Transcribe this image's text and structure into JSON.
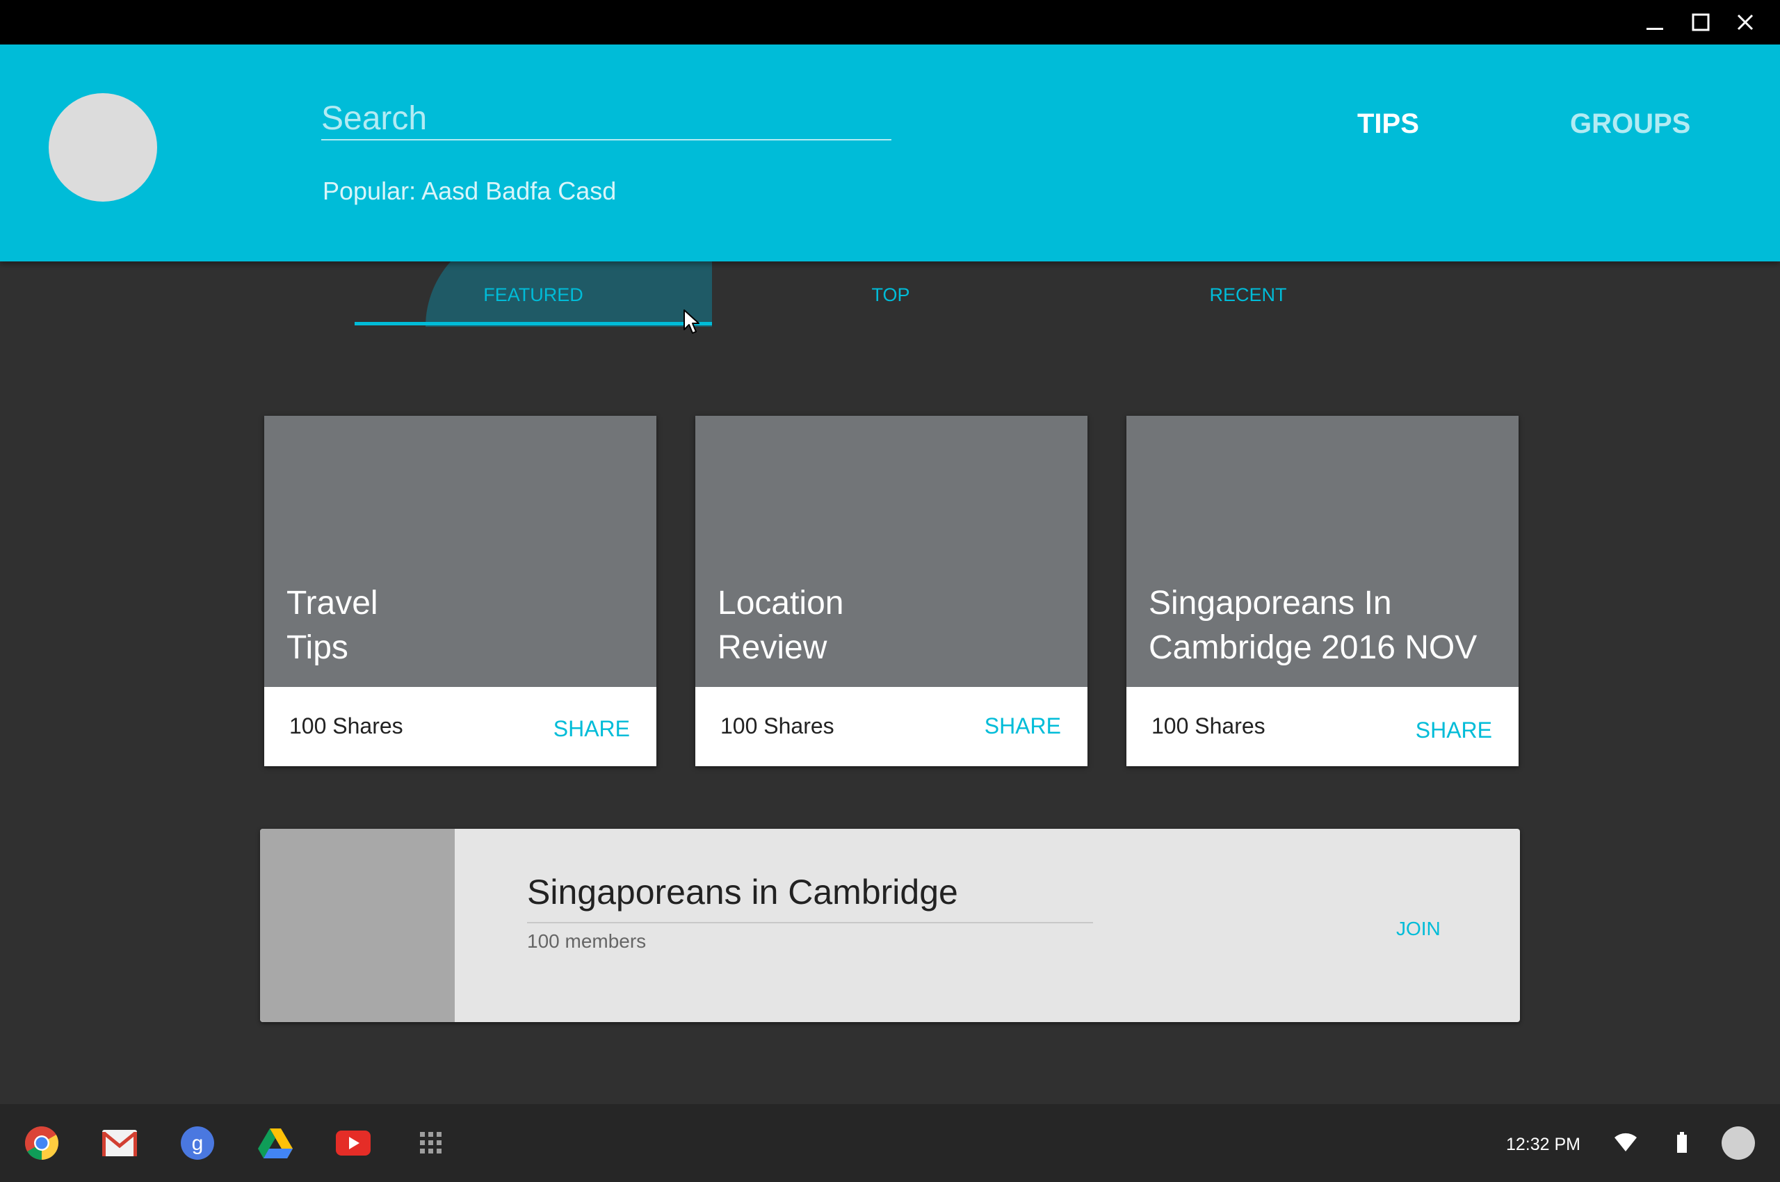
{
  "window": {
    "controls": {
      "minimize": "minimize-icon",
      "maximize": "maximize-icon",
      "close": "close-icon"
    }
  },
  "header": {
    "search": {
      "placeholder": "Search",
      "value": ""
    },
    "popular": "Popular: Aasd Badfa Casd",
    "nav": [
      {
        "label": "TIPS",
        "active": true
      },
      {
        "label": "GROUPS",
        "active": false
      }
    ]
  },
  "subtabs": [
    {
      "label": "FEATURED",
      "active": true
    },
    {
      "label": "TOP",
      "active": false
    },
    {
      "label": "RECENT",
      "active": false
    }
  ],
  "cards": [
    {
      "title": "Travel\nTips",
      "shares": "100 Shares",
      "action": "SHARE"
    },
    {
      "title": "Location\nReview",
      "shares": "100 Shares",
      "action": "SHARE"
    },
    {
      "title": "Singaporeans In\nCambridge 2016 NOV",
      "shares": "100 Shares",
      "action": "SHARE"
    }
  ],
  "group": {
    "name": "Singaporeans in Cambridge",
    "members": "100 members",
    "action": "JOIN"
  },
  "shelf": {
    "apps": [
      "chrome-icon",
      "gmail-icon",
      "google-search-icon",
      "drive-icon",
      "youtube-icon",
      "app-launcher-icon"
    ],
    "time": "12:32 PM",
    "status_icons": [
      "wifi-icon",
      "battery-icon"
    ]
  },
  "colors": {
    "accent": "#00bcd8",
    "background": "#303030",
    "card_image": "#727578"
  }
}
